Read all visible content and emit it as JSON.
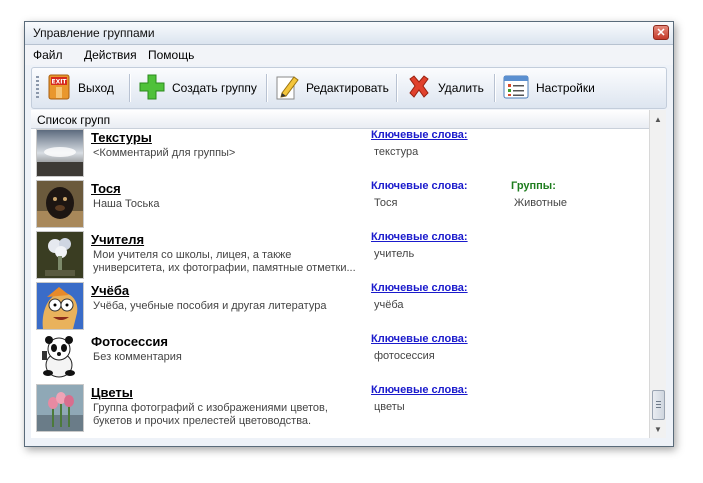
{
  "window": {
    "title": "Управление группами",
    "close_glyph": "✕"
  },
  "menu": [
    "Файл",
    "Действия",
    "Помощь"
  ],
  "toolbar": {
    "exit": "Выход",
    "exit_icon_text": "EXIT",
    "create": "Создать группу",
    "edit": "Редактировать",
    "delete": "Удалить",
    "settings": "Настройки"
  },
  "list": {
    "header": "Список групп",
    "keywords_label": "Ключевые слова:",
    "groups_label": "Группы:",
    "items": [
      {
        "name": "Текстуры",
        "desc": "<Комментарий для группы>",
        "keywords": "текстура",
        "groups": ""
      },
      {
        "name": "Тося",
        "desc": "Наша Тоська",
        "keywords": "Тося",
        "groups": "Животные"
      },
      {
        "name": "Учителя",
        "desc": "Мои учителя со школы, лицея, а также университета, их фотографии, памятные отметки...",
        "keywords": "учитель",
        "groups": ""
      },
      {
        "name": "Учёба",
        "desc": "Учёба, учебные пособия и другая литература",
        "keywords": "учёба",
        "groups": ""
      },
      {
        "name": "Фотосессия",
        "desc": "Без комментария",
        "keywords": "фотосессия",
        "groups": ""
      },
      {
        "name": "Цветы",
        "desc": "Группа фотографий с изображениями цветов, букетов и прочих прелестей цветоводства.",
        "keywords": "цветы",
        "groups": ""
      }
    ]
  },
  "colors": {
    "link_blue": "#1a1acc",
    "group_green": "#1e7d1e"
  }
}
